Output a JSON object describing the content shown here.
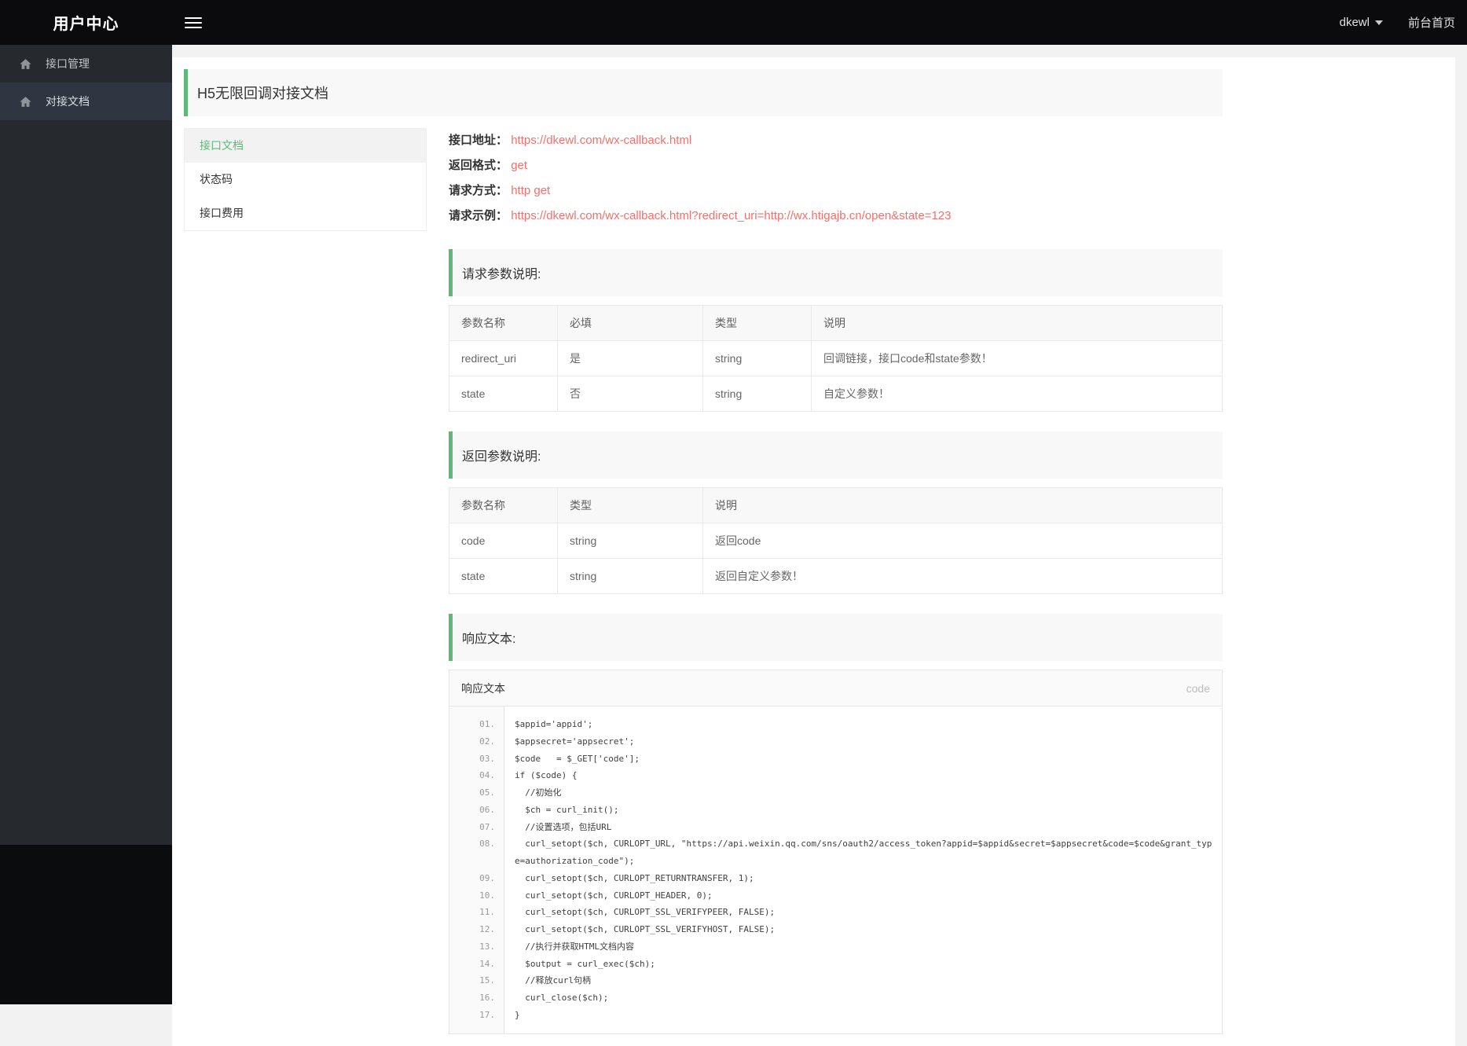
{
  "header": {
    "logo": "用户中心",
    "user": "dkewl",
    "home_link": "前台首页"
  },
  "sidebar": {
    "items": [
      {
        "label": "接口管理"
      },
      {
        "label": "对接文档"
      }
    ]
  },
  "page": {
    "title": "H5无限回调对接文档"
  },
  "submenu": {
    "items": [
      {
        "label": "接口文档"
      },
      {
        "label": "状态码"
      },
      {
        "label": "接口费用"
      }
    ]
  },
  "api_info": {
    "lines": [
      {
        "label": "接口地址：",
        "value": "https://dkewl.com/wx-callback.html"
      },
      {
        "label": "返回格式：",
        "value": "get"
      },
      {
        "label": "请求方式：",
        "value": "http get"
      },
      {
        "label": "请求示例：",
        "value": "https://dkewl.com/wx-callback.html?redirect_uri=http://wx.htigajb.cn/open&state=123"
      }
    ]
  },
  "request_params": {
    "title": "请求参数说明:",
    "headers": [
      "参数名称",
      "必填",
      "类型",
      "说明"
    ],
    "rows": [
      [
        "redirect_uri",
        "是",
        "string",
        "回调链接，接口code和state参数！"
      ],
      [
        "state",
        "否",
        "string",
        "自定义参数！"
      ]
    ]
  },
  "response_params": {
    "title": "返回参数说明:",
    "headers": [
      "参数名称",
      "类型",
      "说明"
    ],
    "rows": [
      [
        "code",
        "string",
        "返回code"
      ],
      [
        "state",
        "string",
        "返回自定义参数！"
      ]
    ]
  },
  "response_text": {
    "title": "响应文本:",
    "box_title": "响应文本",
    "box_tag": "code",
    "code_lines": [
      {
        "num": "01.",
        "text": "$appid='appid';"
      },
      {
        "num": "02.",
        "text": "$appsecret='appsecret';"
      },
      {
        "num": "03.",
        "text": "$code   = $_GET['code'];"
      },
      {
        "num": "04.",
        "text": "if ($code) {"
      },
      {
        "num": "05.",
        "text": "  //初始化"
      },
      {
        "num": "06.",
        "text": "  $ch = curl_init();"
      },
      {
        "num": "07.",
        "text": "  //设置选项，包括URL"
      },
      {
        "num": "08.",
        "text": "  curl_setopt($ch, CURLOPT_URL, \"https://api.weixin.qq.com/sns/oauth2/access_token?appid=$appid&secret=$appsecret&code=$code&grant_type=authorization_code\");"
      },
      {
        "num": "09.",
        "text": "  curl_setopt($ch, CURLOPT_RETURNTRANSFER, 1);"
      },
      {
        "num": "10.",
        "text": "  curl_setopt($ch, CURLOPT_HEADER, 0);"
      },
      {
        "num": "11.",
        "text": "  curl_setopt($ch, CURLOPT_SSL_VERIFYPEER, FALSE);"
      },
      {
        "num": "12.",
        "text": "  curl_setopt($ch, CURLOPT_SSL_VERIFYHOST, FALSE);"
      },
      {
        "num": "13.",
        "text": "  //执行并获取HTML文档内容"
      },
      {
        "num": "14.",
        "text": "  $output = curl_exec($ch);"
      },
      {
        "num": "15.",
        "text": "  //释放curl句柄"
      },
      {
        "num": "16.",
        "text": "  curl_close($ch);"
      },
      {
        "num": "17.",
        "text": "}"
      }
    ]
  },
  "colors": {
    "accent_green": "#5FB878",
    "link_red": "#f56f6c"
  }
}
